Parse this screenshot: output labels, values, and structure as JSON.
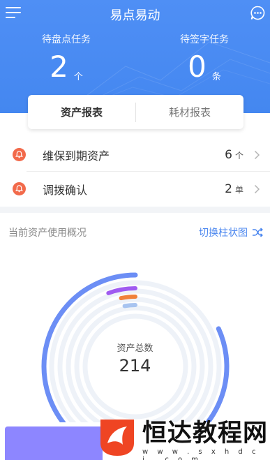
{
  "app": {
    "title": "易点易动"
  },
  "header": {
    "pending_inventory": {
      "label": "待盘点任务",
      "value": "2",
      "unit": "个"
    },
    "pending_signature": {
      "label": "待签字任务",
      "value": "0",
      "unit": "条"
    }
  },
  "reports": {
    "tabs": [
      {
        "label": "资产报表"
      },
      {
        "label": "耗材报表"
      }
    ]
  },
  "tasks": [
    {
      "label": "维保到期资产",
      "count": "6",
      "unit": "个"
    },
    {
      "label": "调拨确认",
      "count": "2",
      "unit": "单"
    }
  ],
  "overview": {
    "title": "当前资产使用概况",
    "switch_label": "切换柱状图",
    "center_label": "资产总数",
    "total": "214"
  },
  "chart_data": {
    "type": "radial-bar",
    "total": 214,
    "series": [
      {
        "value": 175,
        "color": "#6c8ef5"
      },
      {
        "value": 12,
        "color": "#a05bf0"
      },
      {
        "value": 7,
        "color": "#f0813a"
      },
      {
        "value": 6,
        "color": "#a8c4f0"
      }
    ]
  },
  "colors": {
    "header": "#4a8af2",
    "accent": "#4a86ef",
    "alert": "#f26a4b",
    "button": "#8d86ff"
  },
  "watermark": {
    "text": "恒达教程网",
    "url": "w w w . s x h d c j . c o m"
  },
  "icons": {
    "menu": "menu-icon",
    "chat": "chat-bubble-icon",
    "bell": "bell-icon",
    "chevron": "chevron-right-icon",
    "shuffle": "shuffle-icon"
  }
}
